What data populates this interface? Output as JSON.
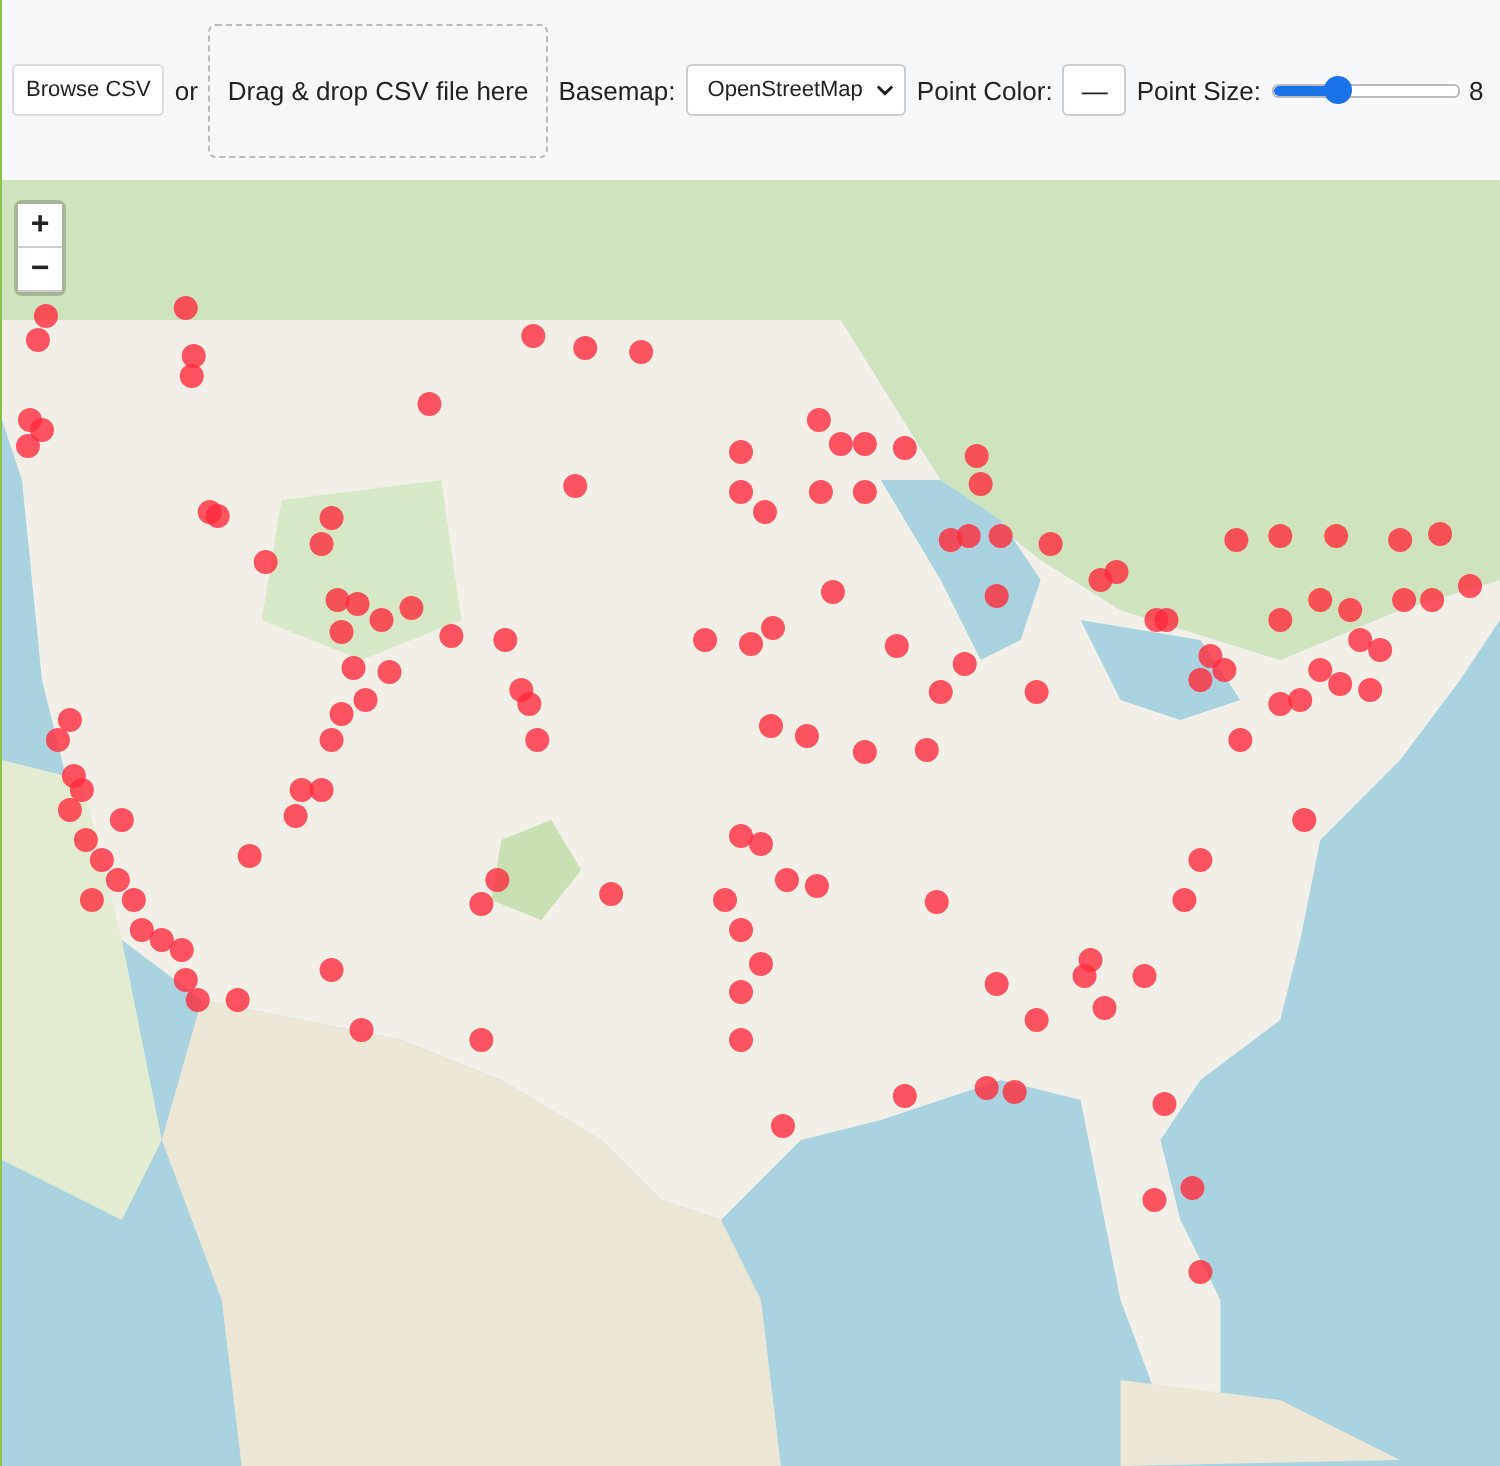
{
  "toolbar": {
    "browse_button": "Browse CSV",
    "or_text": "or",
    "drop_zone": "Drag & drop CSV file here",
    "basemap": {
      "label": "Basemap:",
      "value": "OpenStreetMap"
    },
    "point_color": {
      "label": "Point Color:",
      "value": "—"
    },
    "point_size": {
      "label": "Point Size:",
      "level": 0.35,
      "reading": "8"
    }
  },
  "map": {
    "zoom_controls": [
      "+",
      "−"
    ]
  }
}
